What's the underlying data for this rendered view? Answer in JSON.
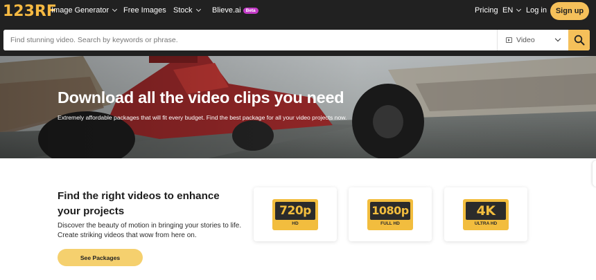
{
  "nav": {
    "logo": "123RF",
    "items": [
      {
        "label": "Image Generator",
        "dropdown": true
      },
      {
        "label": "Free Images",
        "dropdown": false
      },
      {
        "label": "Stock",
        "dropdown": true
      },
      {
        "label": "Blieve.ai",
        "badge": "Beta"
      }
    ],
    "pricing": "Pricing",
    "language": "EN",
    "login": "Log in",
    "signup": "Sign up"
  },
  "search": {
    "placeholder": "Find stunning video. Search by keywords or phrase.",
    "value": "",
    "type_selected": "Video",
    "type_icon": "video-icon",
    "button_icon": "search-icon"
  },
  "hero": {
    "title": "Download all the video clips you need",
    "subtitle": "Extremely affordable packages that will fit every budget. Find the best package for all your video projects now."
  },
  "feature": {
    "title": "Find the right videos to enhance your projects",
    "description": "Discover the beauty of motion in bringing your stories to life. Create striking videos that wow from here on.",
    "cta": "See Packages"
  },
  "resolutions": [
    {
      "label": "720p",
      "sub": "HD"
    },
    {
      "label": "1080p",
      "sub": "FULL HD"
    },
    {
      "label": "4K",
      "sub": "ULTRA HD"
    }
  ],
  "colors": {
    "nav_bg": "#212121",
    "accent": "#f5c05a",
    "beta_badge": "#c23ac6",
    "badge_gold": "#f2bd3e"
  }
}
